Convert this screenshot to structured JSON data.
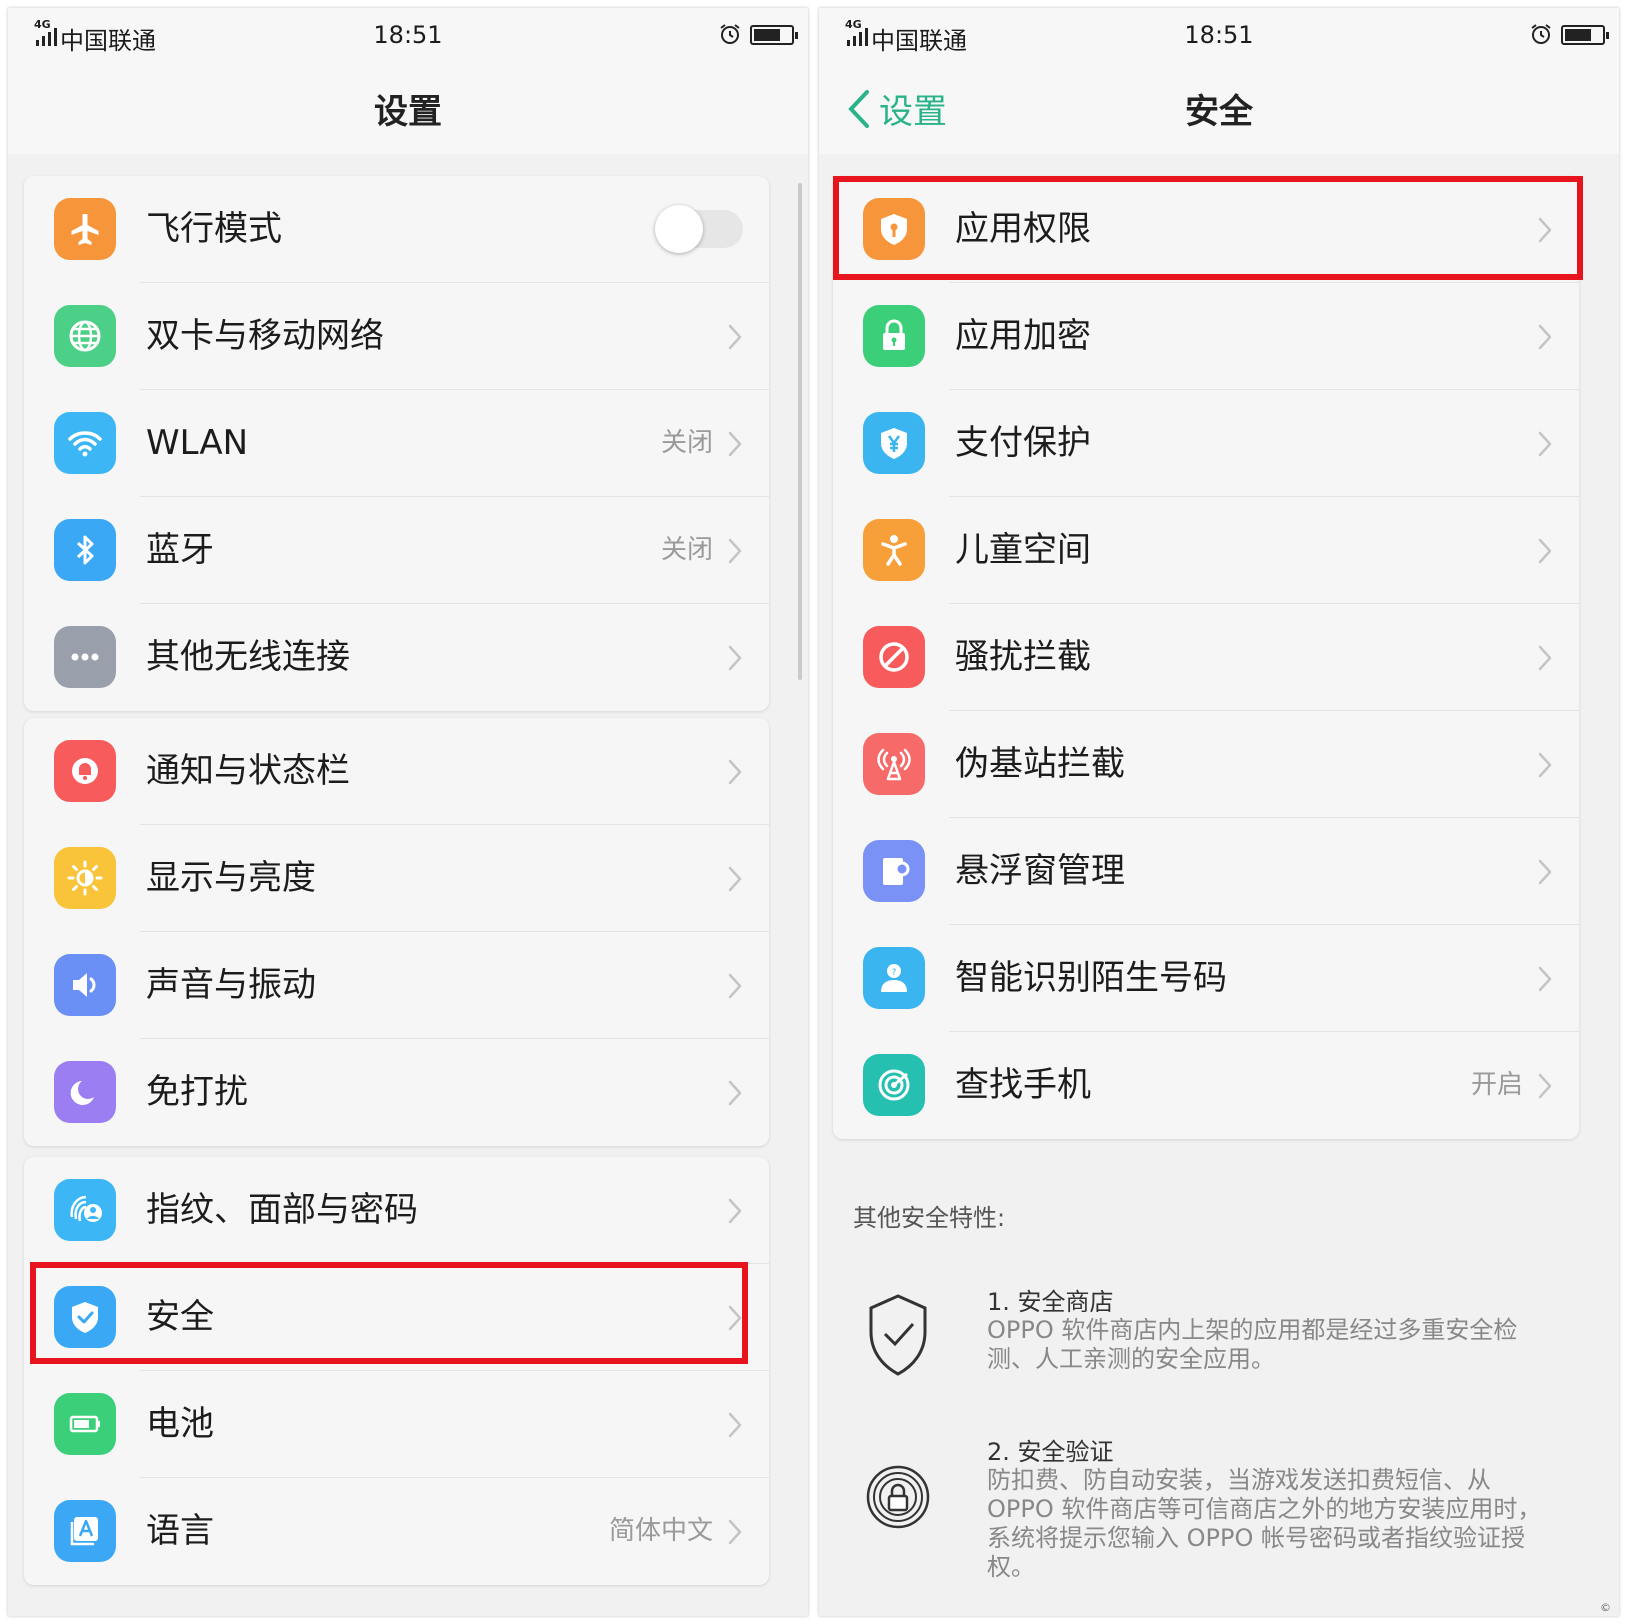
{
  "status_bar": {
    "carrier": "中国联通",
    "time": "18:51",
    "network": "4G"
  },
  "left_screen": {
    "title": "设置",
    "groups": [
      [
        {
          "label": "飞行模式",
          "icon": "airplane-icon",
          "color": "#f7953a",
          "control": "toggle",
          "toggle_on": false
        },
        {
          "label": "双卡与移动网络",
          "icon": "globe-icon",
          "color": "#4ccf86"
        },
        {
          "label": "WLAN",
          "icon": "wifi-icon",
          "color": "#3cb6f5",
          "value": "关闭"
        },
        {
          "label": "蓝牙",
          "icon": "bluetooth-icon",
          "color": "#3aa8f5",
          "value": "关闭"
        },
        {
          "label": "其他无线连接",
          "icon": "more-icon",
          "color": "#9aa0ab"
        }
      ],
      [
        {
          "label": "通知与状态栏",
          "icon": "bell-icon",
          "color": "#f75b5b"
        },
        {
          "label": "显示与亮度",
          "icon": "brightness-icon",
          "color": "#f9c33a"
        },
        {
          "label": "声音与振动",
          "icon": "speaker-icon",
          "color": "#6a8ff5"
        },
        {
          "label": "免打扰",
          "icon": "moon-icon",
          "color": "#9b7ff2"
        }
      ],
      [
        {
          "label": "指纹、面部与密码",
          "icon": "fingerprint-face-icon",
          "color": "#3cb6f5"
        },
        {
          "label": "安全",
          "icon": "shield-check-icon",
          "color": "#3aa8f5"
        },
        {
          "label": "电池",
          "icon": "battery-icon",
          "color": "#3ccf7a"
        },
        {
          "label": "语言",
          "icon": "language-icon",
          "color": "#3ca8f5",
          "value": "简体中文"
        }
      ]
    ]
  },
  "right_screen": {
    "back_label": "设置",
    "title": "安全",
    "items": [
      {
        "label": "应用权限",
        "icon": "shield-key-icon",
        "color": "#f7953a"
      },
      {
        "label": "应用加密",
        "icon": "lock-icon",
        "color": "#3ccf7a"
      },
      {
        "label": "支付保护",
        "icon": "shield-yen-icon",
        "color": "#3ab5f0"
      },
      {
        "label": "儿童空间",
        "icon": "child-icon",
        "color": "#f7a03a"
      },
      {
        "label": "骚扰拦截",
        "icon": "block-icon",
        "color": "#f75b5b"
      },
      {
        "label": "伪基站拦截",
        "icon": "antenna-icon",
        "color": "#f76a6a"
      },
      {
        "label": "悬浮窗管理",
        "icon": "floating-window-icon",
        "color": "#7a92f5"
      },
      {
        "label": "智能识别陌生号码",
        "icon": "unknown-caller-icon",
        "color": "#3ab5f0"
      },
      {
        "label": "查找手机",
        "icon": "radar-icon",
        "color": "#26c0b0",
        "value": "开启"
      }
    ],
    "other_features_title": "其他安全特性:",
    "features": [
      {
        "title": "1. 安全商店",
        "desc": "OPPO 软件商店内上架的应用都是经过多重安全检测、人工亲测的安全应用。",
        "icon": "shield-check-outline-icon"
      },
      {
        "title": "2. 安全验证",
        "desc": "防扣费、防自动安装，当游戏发送扣费短信、从 OPPO 软件商店等可信商店之外的地方安装应用时，系统将提示您输入 OPPO 帐号密码或者指纹验证授权。",
        "icon": "fingerprint-lock-icon"
      }
    ]
  },
  "colors": {
    "accent": "#2ab38b",
    "highlight": "#e8141d"
  }
}
